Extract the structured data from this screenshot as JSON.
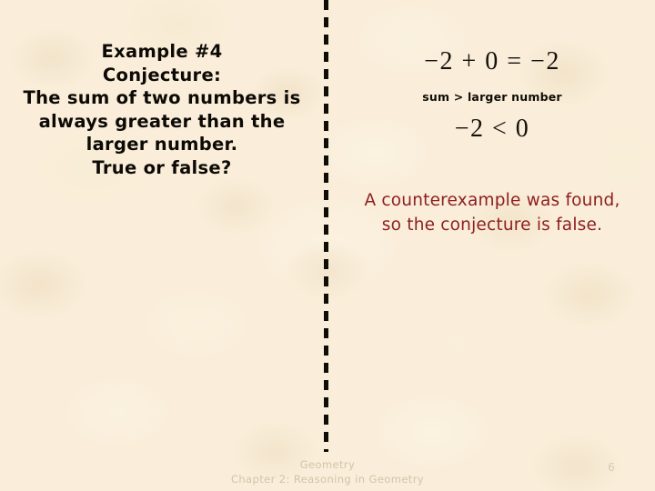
{
  "slide": {
    "background_color": "#faeeda",
    "divider": {
      "name": "vertical-dashed-divider",
      "color": "#100c06",
      "style": "dashed"
    }
  },
  "left_panel": {
    "text_color": "#0d0a06",
    "lines": [
      "Example #4",
      "Conjecture:",
      "The sum of two numbers is",
      "always greater than the",
      "larger number.",
      "True or false?"
    ]
  },
  "right_panel": {
    "equation_top": "−2 + 0 = −2",
    "sum_note": "sum > larger number",
    "equation_bottom": "−2 < 0",
    "conclusion_color": "#8e1f21",
    "conclusion_lines": [
      "A counterexample was found,",
      "so the conjecture is false."
    ]
  },
  "footer": {
    "color": "#d2c3a9",
    "line1": "Geometry",
    "line2": "Chapter 2: Reasoning in Geometry",
    "page_number": "6"
  }
}
